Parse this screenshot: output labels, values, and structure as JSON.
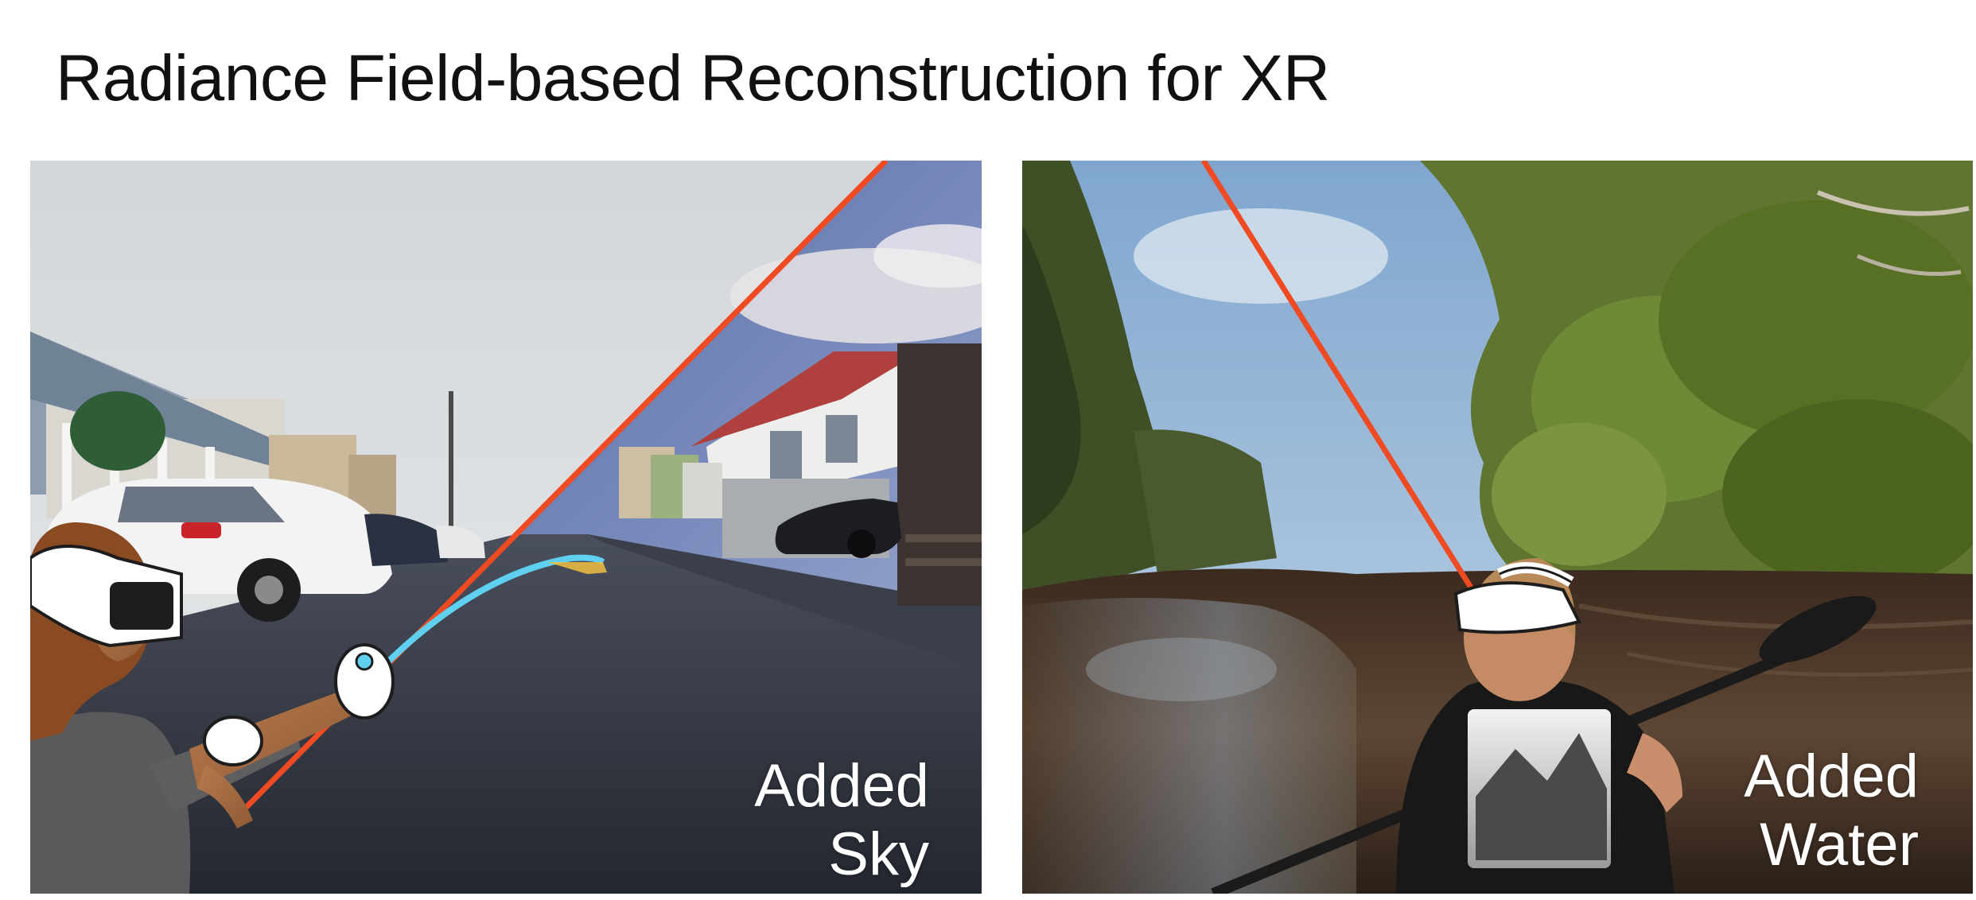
{
  "title": "Radiance Field-based Reconstruction for XR",
  "panels": [
    {
      "scene": "street",
      "caption": {
        "line1": "Added",
        "line2": "Sky"
      }
    },
    {
      "scene": "river",
      "caption": {
        "line1": "Added",
        "line2": "Water"
      }
    }
  ],
  "colors": {
    "divider_line": "#f04a22",
    "controller_ray": "#5fd0f0",
    "caption_text": "#ffffff"
  }
}
